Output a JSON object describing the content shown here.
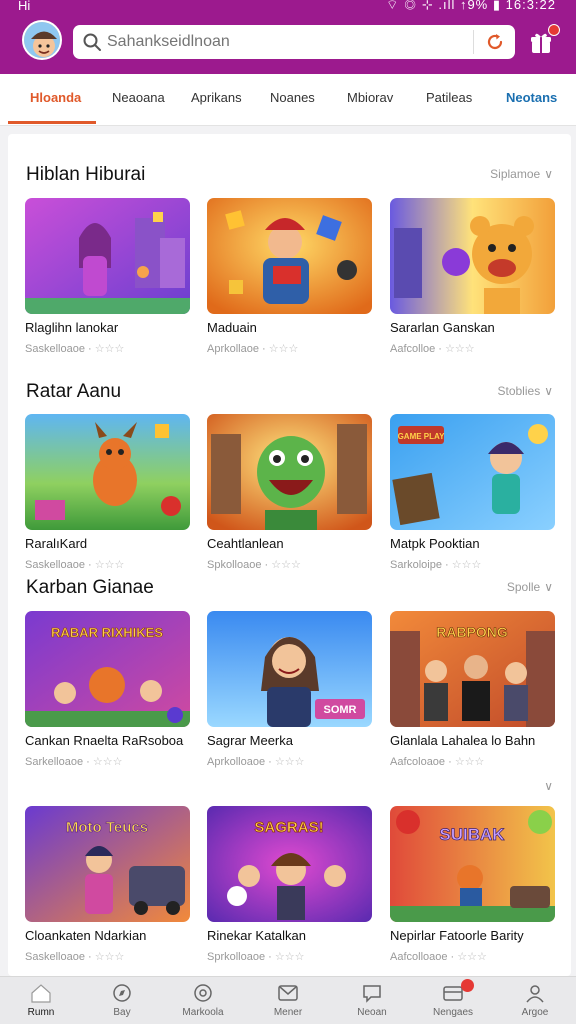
{
  "status": {
    "left": "Hi",
    "right": "⌔ ◎ ⊹ .ıll ↑9% ▮ 16:3:22"
  },
  "search": {
    "placeholder": "Sahankseidlnoan",
    "value": ""
  },
  "tabs": [
    {
      "label": "Hloanda"
    },
    {
      "label": "Neaoana"
    },
    {
      "label": "Aprikans"
    },
    {
      "label": "Noanes"
    },
    {
      "label": "Mbiorav"
    },
    {
      "label": "Patileas"
    },
    {
      "label": "Neotans"
    }
  ],
  "sections": [
    {
      "title": "Hiblan Hiburai",
      "more": "Siplamoe",
      "cards": [
        {
          "title": "Rlaglihn lanokar",
          "meta": "Saskelloaoe ·"
        },
        {
          "title": "Maduain",
          "meta": "Aprkollaoe ·"
        },
        {
          "title": "Sararlan Ganskan",
          "meta": "Aafcolloe ·"
        }
      ]
    },
    {
      "title": "Ratar Aanu",
      "more": "Stoblies",
      "cards": [
        {
          "title": "RaralıKard",
          "meta": "Saskelloaoe ·"
        },
        {
          "title": "Ceahtlanlean",
          "meta": "Spkolloaoe ·"
        },
        {
          "title": "Matpk Pooktian",
          "meta": "Sarkoloipe ·"
        }
      ]
    },
    {
      "title": "Karban Gianae",
      "more": "Spolle",
      "cards": [
        {
          "title": "Cankan Rnaelta RaRsoboa",
          "meta": "Sarkelloaoe ·"
        },
        {
          "title": "Sagrar Meerka",
          "meta": "Aprkolloaoe ·"
        },
        {
          "title": "Glanlala Lahalea lo Bahn",
          "meta": "Aafcoloaoe ·"
        }
      ]
    },
    {
      "title": "",
      "more": "",
      "cards": [
        {
          "title": "Cloankaten Ndarkian",
          "meta": "Saskelloaoe ·"
        },
        {
          "title": "Rinekar Katalkan",
          "meta": "Sprkolloaoe ·"
        },
        {
          "title": "Nepirlar Fatoorle Barity",
          "meta": "Aafcolloaoe ·"
        }
      ]
    }
  ],
  "thumb_texts": {
    "s3c1": "RABAR RIXHIKES",
    "s3c2": "SOMR",
    "s3c3": "RABPONG",
    "s4c1": "Moto Teucs",
    "s4c2": "SAGRAS!",
    "s4c3": "SUIBAK",
    "s2c3": "GAME PLAY"
  },
  "stars": "☆☆☆",
  "bottom_nav": [
    {
      "label": "Rumn"
    },
    {
      "label": "Bay"
    },
    {
      "label": "Markoola"
    },
    {
      "label": "Mener"
    },
    {
      "label": "Neoan"
    },
    {
      "label": "Nengaes"
    },
    {
      "label": "Argoe"
    }
  ],
  "colors": {
    "brand": "#9c1a8e",
    "accent": "#e0592a",
    "tab_blue": "#1a6fb0"
  }
}
